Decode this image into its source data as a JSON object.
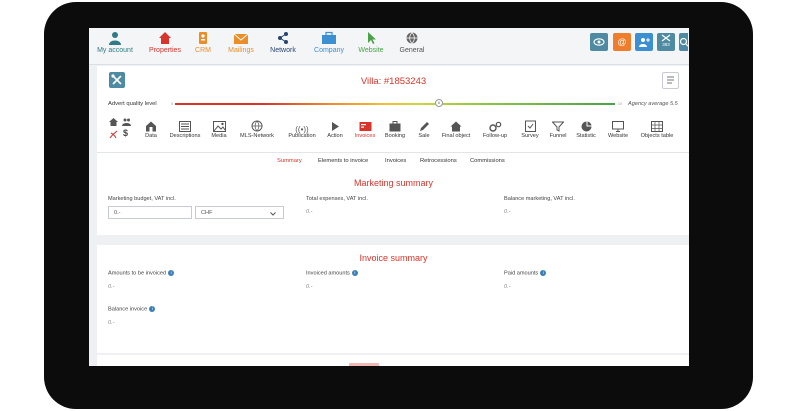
{
  "nav": {
    "items": [
      {
        "label": "My account",
        "color": "#2f7c86"
      },
      {
        "label": "Properties",
        "color": "#d9342b"
      },
      {
        "label": "CRM",
        "color": "#e98e28"
      },
      {
        "label": "Mailings",
        "color": "#e98e28"
      },
      {
        "label": "Network",
        "color": "#27456e"
      },
      {
        "label": "Company",
        "color": "#3c8fd0"
      },
      {
        "label": "Website",
        "color": "#4aa148"
      },
      {
        "label": "General",
        "color": "#555555"
      }
    ],
    "quick_badge": "383"
  },
  "header": {
    "title": "Villa: #1853243"
  },
  "quality": {
    "label": "Advert quality level",
    "score": "6",
    "agency_average": "Agency average 5.5",
    "min": "0",
    "max": "10",
    "level": 0.6
  },
  "modules": [
    {
      "label": "Data"
    },
    {
      "label": "Descriptions"
    },
    {
      "label": "Media"
    },
    {
      "label": "MLS-Network"
    },
    {
      "label": "Publication"
    },
    {
      "label": "Action"
    },
    {
      "label": "Invoices"
    },
    {
      "label": "Booking"
    },
    {
      "label": "Sale"
    },
    {
      "label": "Final object"
    },
    {
      "label": "Follow-up"
    },
    {
      "label": "Survey"
    },
    {
      "label": "Funnel"
    },
    {
      "label": "Statistic"
    },
    {
      "label": "Website"
    },
    {
      "label": "Objects table"
    }
  ],
  "subtabs": [
    {
      "label": "Summary"
    },
    {
      "label": "Elements to invoice"
    },
    {
      "label": "Invoices"
    },
    {
      "label": "Retrocessions"
    },
    {
      "label": "Commissions"
    }
  ],
  "marketing": {
    "title": "Marketing summary",
    "budget_label": "Marketing budget, VAT incl.",
    "budget_value": "0.-",
    "currency": "CHF",
    "expenses_label": "Total expenses, VAT incl.",
    "expenses_value": "0.-",
    "balance_label": "Balance marketing, VAT incl.",
    "balance_value": "0.-"
  },
  "invoice": {
    "title": "Invoice summary",
    "to_invoice_label": "Amounts to be invoiced",
    "to_invoice_value": "0.-",
    "invoiced_label": "Invoiced amounts",
    "invoiced_value": "0.-",
    "paid_label": "Paid amounts",
    "paid_value": "0.-",
    "balance_label": "Balance invoice",
    "balance_value": "0.-"
  },
  "icons": {
    "info": "i"
  }
}
